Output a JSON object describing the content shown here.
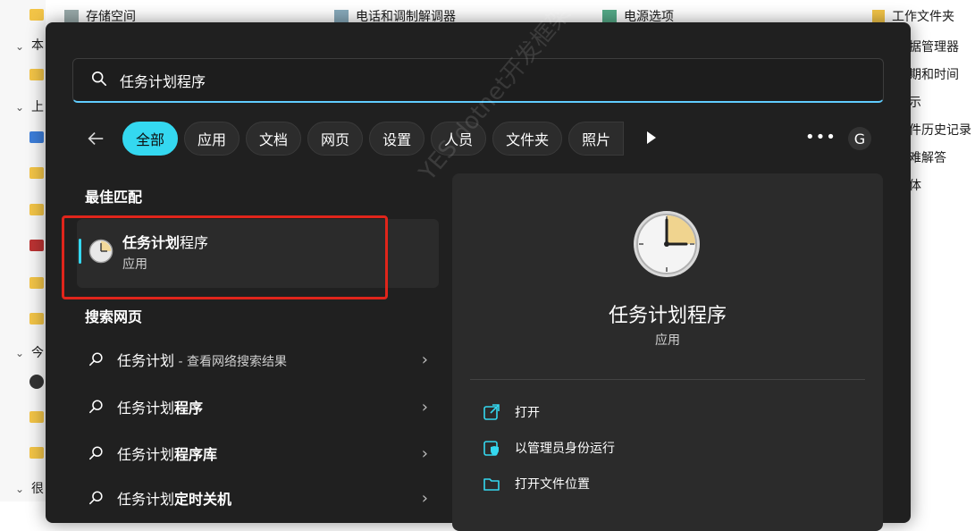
{
  "background": {
    "top_items": [
      "存储空间",
      "电话和调制解调器",
      "电源选项",
      "工作文件夹"
    ],
    "left_labels": [
      "本",
      "上",
      "今",
      "很"
    ],
    "right_items": [
      "据管理器",
      "期和时间",
      "示",
      "件历史记录",
      "难解答",
      "体"
    ]
  },
  "search": {
    "query": "任务计划程序",
    "icon": "search-icon"
  },
  "filters": {
    "back_icon": "arrow-left-icon",
    "chips": [
      "全部",
      "应用",
      "文档",
      "网页",
      "设置",
      "人员",
      "文件夹",
      "照片"
    ],
    "active_index": 0,
    "play_icon": "play-icon",
    "more_label": "•••",
    "account_label": "G"
  },
  "best_match": {
    "section_title": "最佳匹配",
    "name_bold": "任务计划",
    "name_rest": "程序",
    "subtitle": "应用",
    "icon": "clock-icon"
  },
  "web_search": {
    "section_title": "搜索网页",
    "items": [
      {
        "normal": "任务计划",
        "bold": "",
        "hint": " - 查看网络搜索结果"
      },
      {
        "normal": "任务计划",
        "bold": "程序",
        "hint": ""
      },
      {
        "normal": "任务计划",
        "bold": "程序库",
        "hint": ""
      },
      {
        "normal": "任务计划",
        "bold": "定时关机",
        "hint": ""
      }
    ]
  },
  "detail": {
    "title": "任务计划程序",
    "subtitle": "应用",
    "actions": [
      {
        "label": "打开",
        "icon": "open-external-icon"
      },
      {
        "label": "以管理员身份运行",
        "icon": "shield-admin-icon"
      },
      {
        "label": "打开文件位置",
        "icon": "folder-icon"
      }
    ]
  },
  "watermark": "YES dotnet开发框架 www.yesdotnet.com",
  "colors": {
    "accent": "#34d8f0",
    "panel": "#202020",
    "card": "#2b2b2b",
    "highlight_box": "#e0251b"
  }
}
